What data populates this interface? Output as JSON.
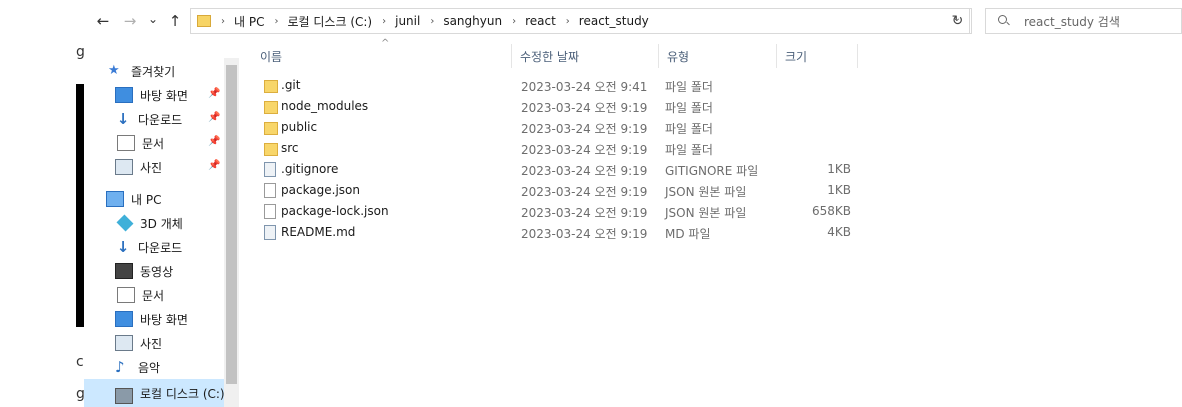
{
  "nav": {
    "back": "←",
    "forward": "→",
    "recent": "⌄",
    "up": "↑"
  },
  "address": {
    "crumbs": [
      "내 PC",
      "로컬 디스크 (C:)",
      "junil",
      "sanghyun",
      "react",
      "react_study"
    ],
    "dropdown": "⌄",
    "refresh": "↻"
  },
  "search": {
    "placeholder": "react_study 검색"
  },
  "sidebar": {
    "quick_access": {
      "label": "즐겨찾기",
      "items": [
        {
          "label": "바탕 화면",
          "icon": "desktop-icon"
        },
        {
          "label": "다운로드",
          "icon": "download-icon"
        },
        {
          "label": "문서",
          "icon": "document-icon"
        },
        {
          "label": "사진",
          "icon": "picture-icon"
        }
      ]
    },
    "this_pc": {
      "label": "내 PC",
      "items": [
        {
          "label": "3D 개체",
          "icon": "3d-objects-icon"
        },
        {
          "label": "다운로드",
          "icon": "download-icon"
        },
        {
          "label": "동영상",
          "icon": "video-icon"
        },
        {
          "label": "문서",
          "icon": "document-icon"
        },
        {
          "label": "바탕 화면",
          "icon": "desktop-icon"
        },
        {
          "label": "사진",
          "icon": "picture-icon"
        },
        {
          "label": "음악",
          "icon": "music-icon"
        },
        {
          "label": "로컬 디스크 (C:)",
          "icon": "drive-icon"
        }
      ]
    }
  },
  "columns": {
    "name": "이름",
    "date": "수정한 날짜",
    "type": "유형",
    "size": "크기"
  },
  "files": [
    {
      "name": ".git",
      "date": "2023-03-24 오전 9:41",
      "type": "파일 폴더",
      "size": "",
      "icon": "folder-icon"
    },
    {
      "name": "node_modules",
      "date": "2023-03-24 오전 9:19",
      "type": "파일 폴더",
      "size": "",
      "icon": "folder-icon"
    },
    {
      "name": "public",
      "date": "2023-03-24 오전 9:19",
      "type": "파일 폴더",
      "size": "",
      "icon": "folder-icon"
    },
    {
      "name": "src",
      "date": "2023-03-24 오전 9:19",
      "type": "파일 폴더",
      "size": "",
      "icon": "folder-icon"
    },
    {
      "name": ".gitignore",
      "date": "2023-03-24 오전 9:19",
      "type": "GITIGNORE 파일",
      "size": "1KB",
      "icon": "gitignore-file-icon"
    },
    {
      "name": "package.json",
      "date": "2023-03-24 오전 9:19",
      "type": "JSON 원본 파일",
      "size": "1KB",
      "icon": "json-file-icon"
    },
    {
      "name": "package-lock.json",
      "date": "2023-03-24 오전 9:19",
      "type": "JSON 원본 파일",
      "size": "658KB",
      "icon": "json-file-icon"
    },
    {
      "name": "README.md",
      "date": "2023-03-24 오전 9:19",
      "type": "MD 파일",
      "size": "4KB",
      "icon": "md-file-icon"
    }
  ],
  "background_window": {
    "chars": [
      "g",
      "c",
      "g"
    ]
  }
}
